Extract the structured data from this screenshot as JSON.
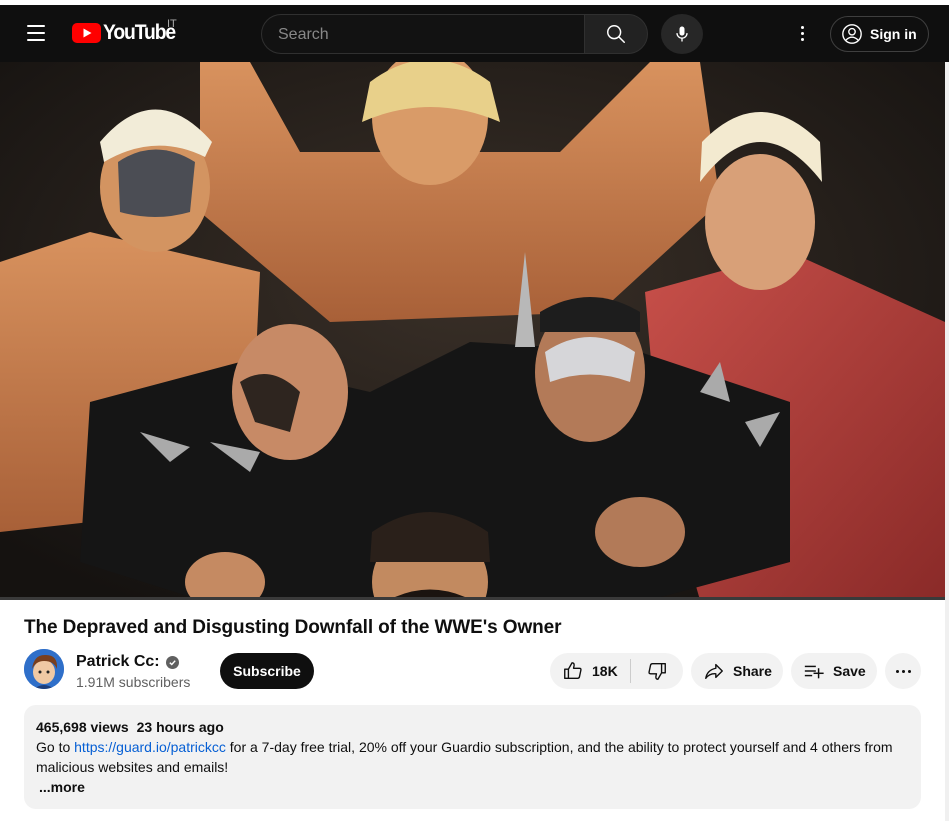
{
  "masthead": {
    "logo_text": "YouTube",
    "country_code": "IT",
    "search_placeholder": "Search",
    "signin_label": "Sign in"
  },
  "video": {
    "title": "The Depraved and Disgusting Downfall of the WWE's Owner"
  },
  "channel": {
    "name": "Patrick Cc:",
    "subscribers": "1.91M subscribers",
    "subscribe_label": "Subscribe"
  },
  "actions": {
    "like_count": "18K",
    "share_label": "Share",
    "save_label": "Save"
  },
  "description": {
    "views": "465,698 views",
    "age": "23 hours ago",
    "text_before_link": "Go to ",
    "link": "https://guard.io/patrickcc",
    "text_after_link": " for a 7-day free trial, 20% off your Guardio subscription, and the ability to protect yourself and 4 others from malicious websites and emails!",
    "more_label": "...more"
  },
  "colors": {
    "masthead_bg": "#0f0f0f",
    "brand_red": "#ff0000",
    "link_blue": "#065fd4",
    "pill_bg": "#f2f2f2"
  }
}
